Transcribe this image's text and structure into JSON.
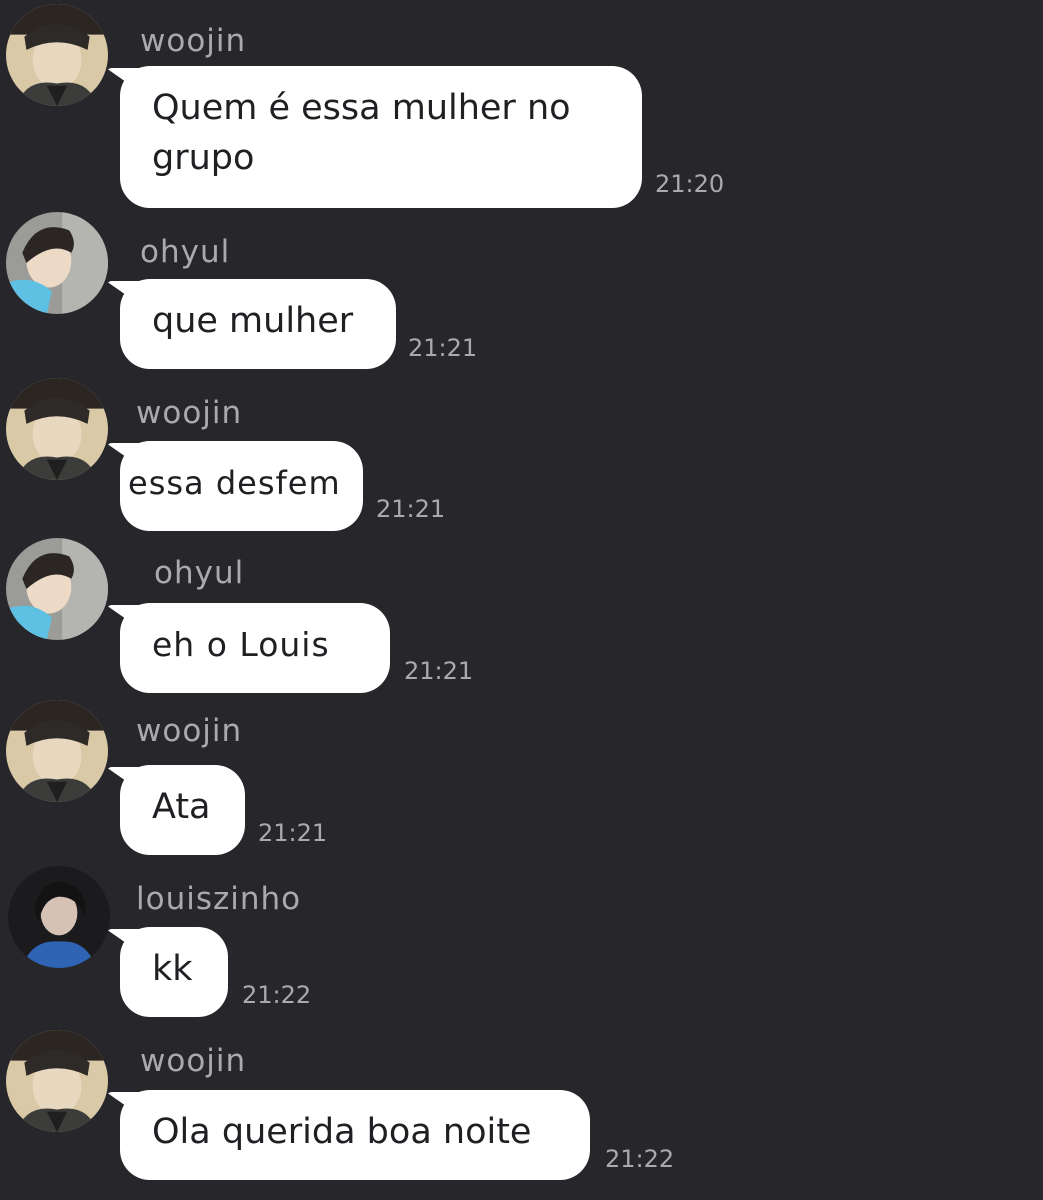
{
  "chat": {
    "messages": [
      {
        "sender": "woojin",
        "avatar": "woojin-avatar",
        "text_lines": [
          "Quem é essa mulher no",
          "grupo"
        ],
        "time": "21:20"
      },
      {
        "sender": "ohyul",
        "avatar": "ohyul-avatar",
        "text_lines": [
          "que mulher"
        ],
        "time": "21:21"
      },
      {
        "sender": "woojin",
        "avatar": "woojin-avatar",
        "text_lines": [
          "essa desfem"
        ],
        "time": "21:21"
      },
      {
        "sender": "ohyul",
        "avatar": "ohyul-avatar",
        "text_lines": [
          "eh o Louis"
        ],
        "time": "21:21"
      },
      {
        "sender": "woojin",
        "avatar": "woojin-avatar",
        "text_lines": [
          "Ata"
        ],
        "time": "21:21"
      },
      {
        "sender": "louiszinho",
        "avatar": "louiszinho-avatar",
        "text_lines": [
          "kk"
        ],
        "time": "21:22"
      },
      {
        "sender": "woojin",
        "avatar": "woojin-avatar",
        "text_lines": [
          "Ola querida boa noite"
        ],
        "time": "21:22"
      }
    ]
  },
  "colors": {
    "background": "#27272b",
    "bubble": "#ffffff",
    "bubble_text": "#202024",
    "meta_text": "#a9a9ae"
  }
}
